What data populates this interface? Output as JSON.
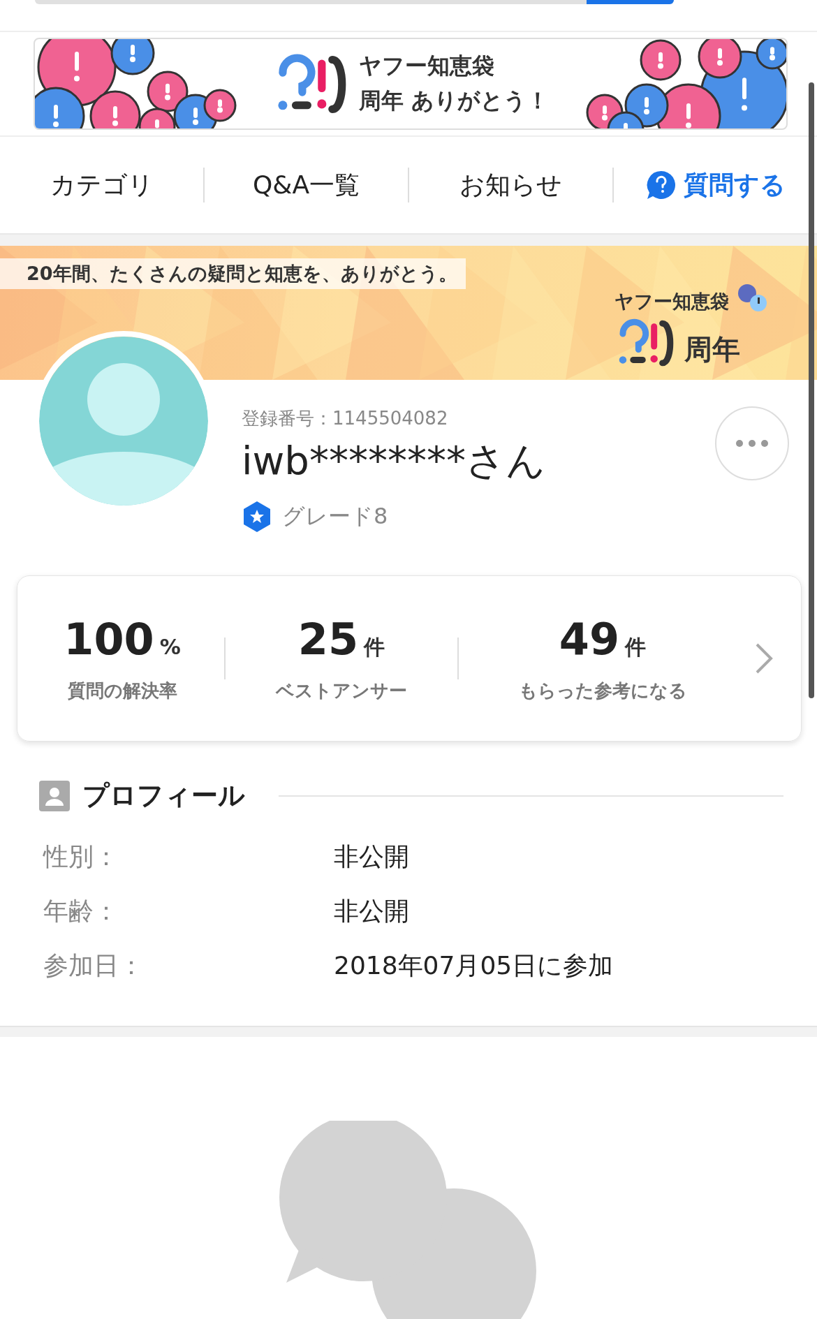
{
  "banner": {
    "line_1": "ヤフー知恵袋",
    "line_2": "周年 ありがとう！"
  },
  "nav": [
    {
      "label": "カテゴリ",
      "kind": "link"
    },
    {
      "label": "Q&A一覧",
      "kind": "link"
    },
    {
      "label": "お知らせ",
      "kind": "link"
    },
    {
      "label": "質問する",
      "kind": "action"
    }
  ],
  "hero": {
    "tagline": "20年間、たくさんの疑問と知恵を、ありがとう。",
    "brand": "ヤフー知恵袋",
    "suffix": "周年"
  },
  "user": {
    "registration": "登録番号：1145504082",
    "name": "iwb********さん",
    "grade": "グレード8"
  },
  "stats": [
    {
      "value": "100",
      "unit": "%",
      "label": "質問の解決率"
    },
    {
      "value": "25",
      "unit": "件",
      "label": "ベストアンサー"
    },
    {
      "value": "49",
      "unit": "件",
      "label": "もらった参考になる"
    }
  ],
  "profile": {
    "title": "プロフィール",
    "rows": [
      {
        "label": "性別：",
        "value": "非公開"
      },
      {
        "label": "年齢：",
        "value": "非公開"
      },
      {
        "label": "参加日：",
        "value": "2018年07月05日に参加"
      }
    ]
  }
}
